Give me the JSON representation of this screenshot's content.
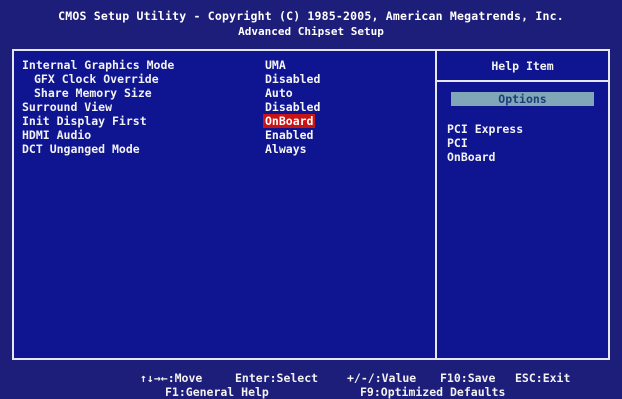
{
  "header": {
    "title": "CMOS Setup Utility - Copyright (C) 1985-2005, American Megatrends, Inc.",
    "subtitle": "Advanced Chipset Setup"
  },
  "settings": [
    {
      "label": "Internal Graphics Mode",
      "value": "UMA"
    },
    {
      "label": "GFX Clock Override",
      "value": "Disabled"
    },
    {
      "label": "Share Memory Size",
      "value": "Auto"
    },
    {
      "label": "Surround View",
      "value": "Disabled"
    },
    {
      "label": "Init Display First",
      "value": "OnBoard"
    },
    {
      "label": "HDMI Audio",
      "value": "Enabled"
    },
    {
      "label": "DCT Unganged Mode",
      "value": "Always"
    }
  ],
  "help": {
    "title": "Help Item",
    "options_label": "Options",
    "options": [
      "PCI Express",
      "PCI",
      "OnBoard"
    ]
  },
  "footer": {
    "move": "↑↓→←:Move",
    "select": "Enter:Select",
    "value": "+/-/:Value",
    "save": "F10:Save",
    "exit": "ESC:Exit",
    "help": "F1:General Help",
    "defaults": "F9:Optimized Defaults"
  },
  "colors": {
    "background": "#0f1490",
    "selected": "#c81414",
    "options_bar": "#7fa7b8"
  }
}
